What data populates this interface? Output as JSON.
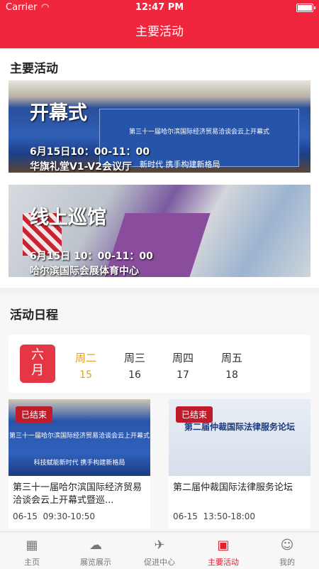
{
  "status_bar": {
    "carrier": "Carrier",
    "time": "12:47 PM"
  },
  "nav": {
    "title": "主要活动"
  },
  "main_section": {
    "title": "主要活动",
    "banners": [
      {
        "title": "开幕式",
        "time": "6月15日10：00-11：00",
        "place": "华旗礼堂V1-V2会议厅",
        "screen_text": "第三十一届哈尔滨国际经济贸易洽谈会云上开幕式",
        "slogan": "新时代  携手构建新格局"
      },
      {
        "title": "线上巡馆",
        "time": "6月15日 10：00-11：00",
        "place": "哈尔滨国际会展体育中心"
      }
    ]
  },
  "schedule": {
    "title": "活动日程",
    "month": [
      "六",
      "月"
    ],
    "days": [
      {
        "weekday": "周二",
        "date": "15",
        "active": true
      },
      {
        "weekday": "周三",
        "date": "16",
        "active": false
      },
      {
        "weekday": "周四",
        "date": "17",
        "active": false
      },
      {
        "weekday": "周五",
        "date": "18",
        "active": false
      }
    ]
  },
  "events": [
    {
      "tag": "已结束",
      "title": "第三十一届哈尔滨国际经济贸易洽谈会云上开幕式暨巡...",
      "date": "06-15",
      "time": "09:30-10:50",
      "image_text": "第三十一届哈尔滨国际经济贸易洽谈会云上开幕式",
      "image_slogan": "科技赋能新时代  携手构建新格局"
    },
    {
      "tag": "已结束",
      "title": "第二届仲裁国际法律服务论坛",
      "date": "06-15",
      "time": "13:50-18:00",
      "image_text": "第二届仲裁国际法律服务论坛"
    }
  ],
  "tabbar": [
    {
      "label": "主页",
      "icon": "home-icon",
      "glyph": "▦"
    },
    {
      "label": "展览展示",
      "icon": "exhibition-icon",
      "glyph": "☁"
    },
    {
      "label": "促进中心",
      "icon": "promotion-icon",
      "glyph": "✈"
    },
    {
      "label": "主要活动",
      "icon": "activity-icon",
      "glyph": "▣",
      "active": true
    },
    {
      "label": "我的",
      "icon": "user-icon",
      "glyph": "☺"
    }
  ],
  "colors": {
    "brand": "#f0263c",
    "active_day": "#e8a020",
    "tag": "#c01b2b"
  }
}
